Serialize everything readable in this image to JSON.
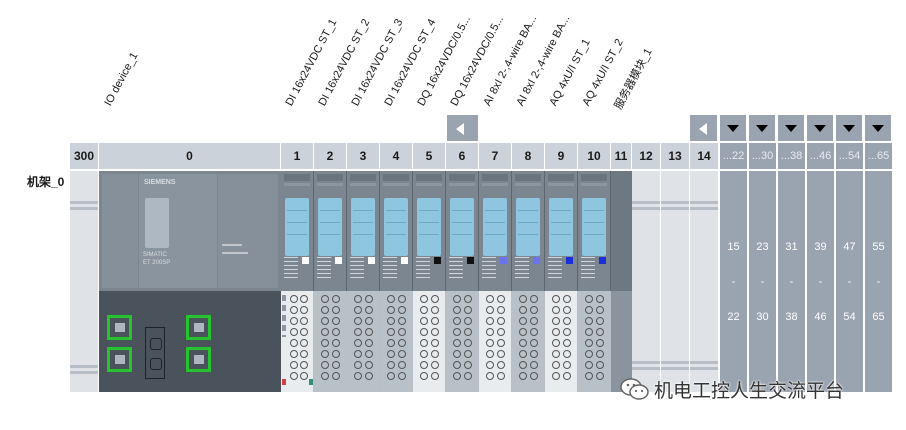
{
  "rack_label": "机架_0",
  "modules": [
    "IO device_1",
    "DI 16x24VDC ST_1",
    "DI 16x24VDC ST_2",
    "DI 16x24VDC ST_3",
    "DI 16x24VDC ST_4",
    "DQ 16x24VDC/0.5...",
    "DQ 16x24VDC/0.5...",
    "AI 8xI 2-,4-wire BA...",
    "AI 8xI 2-,4-wire BA...",
    "AQ 4xU/I ST_1",
    "AQ 4xU/I ST_2",
    "服务器模块_1"
  ],
  "slots": [
    "300",
    "0",
    "1",
    "2",
    "3",
    "4",
    "5",
    "6",
    "7",
    "8",
    "9",
    "10",
    "11",
    "12",
    "13",
    "14"
  ],
  "ranges": [
    {
      "header": "...22",
      "top": "15",
      "dash": "-",
      "bottom": "22"
    },
    {
      "header": "...30",
      "top": "23",
      "dash": "-",
      "bottom": "30"
    },
    {
      "header": "...38",
      "top": "31",
      "dash": "-",
      "bottom": "38"
    },
    {
      "header": "...46",
      "top": "39",
      "dash": "-",
      "bottom": "46"
    },
    {
      "header": "...54",
      "top": "47",
      "dash": "-",
      "bottom": "54"
    },
    {
      "header": "...65",
      "top": "55",
      "dash": "-",
      "bottom": "65"
    }
  ],
  "head_text": {
    "brand": "SIEMENS",
    "line1": "SIMATIC",
    "line2": "ET 200SP"
  },
  "watermark": "机电工控人生交流平台",
  "icons": {
    "scroll_left": "triangle-left-icon",
    "dropdown": "triangle-down-icon",
    "wechat": "wechat-icon"
  },
  "colors": {
    "header": "#ccd2da",
    "range": "#9aa3b0",
    "module": "#7c8690",
    "port_border": "#25c42f"
  }
}
